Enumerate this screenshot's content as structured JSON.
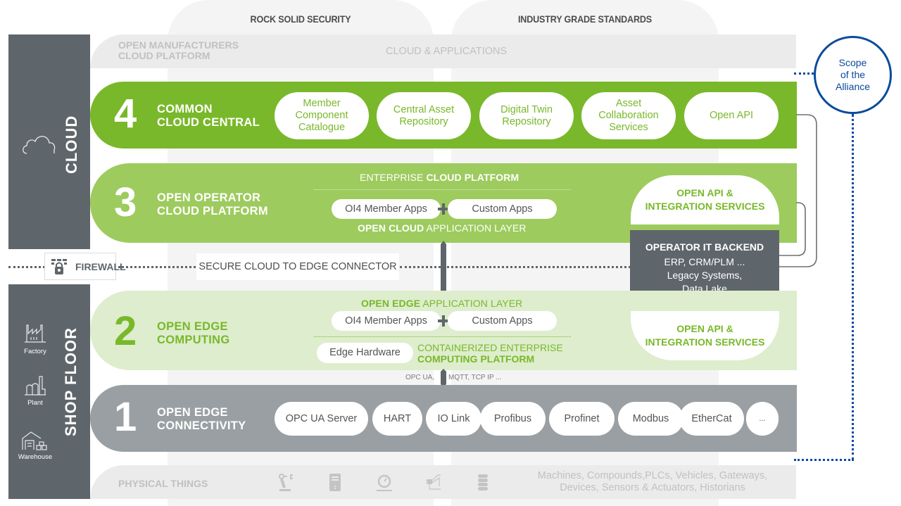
{
  "columns": {
    "security": "ROCK SOLID SECURITY",
    "standards": "INDUSTRY GRADE STANDARDS"
  },
  "top_band": {
    "left_label_line1": "OPEN MANUFACTURERS",
    "left_label_line2": "CLOUD PLATFORM",
    "center_label": "CLOUD & APPLICATIONS"
  },
  "scope": {
    "line1": "Scope",
    "line2": "of the",
    "line3": "Alliance",
    "color": "#0a4a9c"
  },
  "sidebar": {
    "cloud_label": "CLOUD",
    "shopfloor_label": "SHOP FLOOR",
    "icons": [
      {
        "name": "cloud-icon",
        "label": ""
      },
      {
        "name": "factory-icon",
        "label": "Factory"
      },
      {
        "name": "plant-icon",
        "label": "Plant"
      },
      {
        "name": "warehouse-icon",
        "label": "Warehouse"
      }
    ]
  },
  "layers": {
    "l4": {
      "number": "4",
      "title_line1": "COMMON",
      "title_line2": "CLOUD CENTRAL",
      "color": "#79b82a",
      "pills": [
        {
          "l1": "Member",
          "l2": "Component",
          "l3": "Catalogue"
        },
        {
          "l1": "Central Asset",
          "l2": "Repository",
          "l3": ""
        },
        {
          "l1": "Digital Twin",
          "l2": "Repository",
          "l3": ""
        },
        {
          "l1": "Asset",
          "l2": "Collaboration",
          "l3": "Services"
        },
        {
          "l1": "Open API",
          "l2": "",
          "l3": ""
        }
      ]
    },
    "l3": {
      "number": "3",
      "title_line1": "OPEN OPERATOR",
      "title_line2": "CLOUD PLATFORM",
      "color": "#9dcb5e",
      "header_normal": "ENTERPRISE ",
      "header_bold": "CLOUD PLATFORM",
      "apps": [
        "OI4 Member Apps",
        "Custom Apps"
      ],
      "footer_bold": "OPEN CLOUD",
      "footer_normal": " APPLICATION LAYER",
      "api_line1": "OPEN API &",
      "api_line2": "INTEGRATION SERVICES"
    },
    "backend": {
      "title": "OPERATOR IT BACKEND",
      "line1": "ERP, CRM/PLM ...",
      "line2": "Legacy Systems,",
      "line3": "Data Lake",
      "color": "#5f666b"
    },
    "firewall": {
      "label": "FIREWALL",
      "connector": "SECURE CLOUD TO EDGE CONNECTOR"
    },
    "l2": {
      "number": "2",
      "title_line1": "OPEN EDGE",
      "title_line2": "COMPUTING",
      "color": "#deedcd",
      "header_bold": "OPEN EDGE",
      "header_normal": " APPLICATION LAYER",
      "apps": [
        "OI4 Member Apps",
        "Custom Apps"
      ],
      "hardware": "Edge Hardware",
      "platform_line1": "CONTAINERIZED ENTERPRISE",
      "platform_line2": "COMPUTING PLATFORM",
      "api_line1": "OPEN API &",
      "api_line2": "INTEGRATION SERVICES",
      "protocols_left": "OPC UA,",
      "protocols_right": "MQTT, TCP IP ..."
    },
    "l1": {
      "number": "1",
      "title_line1": "OPEN EDGE",
      "title_line2": "CONNECTIVITY",
      "color": "#9a9fa3",
      "pills": [
        "OPC UA Server",
        "HART",
        "IO Link",
        "Profibus",
        "Profinet",
        "Modbus",
        "EtherCat",
        "..."
      ]
    }
  },
  "physical": {
    "label": "PHYSICAL THINGS",
    "icons": [
      "robot-arm-icon",
      "server-icon",
      "sensor-gauge-icon",
      "circuit-chip-icon",
      "database-icon"
    ],
    "desc_line1": "Machines, Compounds,PLCs, Vehicles, Gateways,",
    "desc_line2": "Devices, Sensors & Actuators, Historians"
  }
}
